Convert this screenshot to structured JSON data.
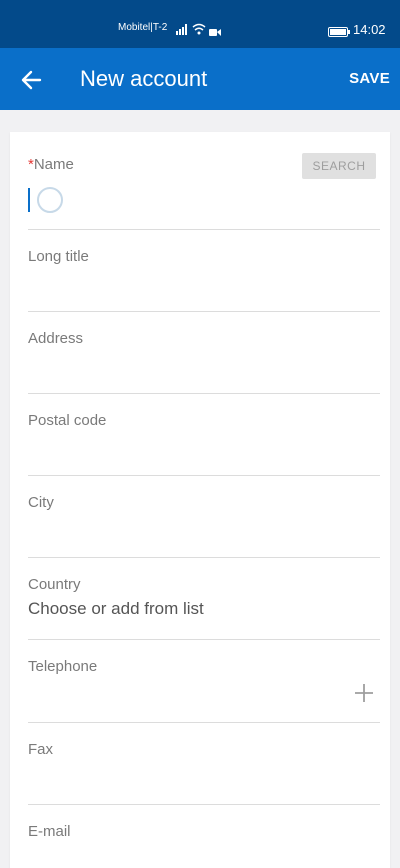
{
  "status_bar": {
    "carrier": "Mobitel|T-2",
    "time": "14:02"
  },
  "app_bar": {
    "title": "New account",
    "save_label": "SAVE"
  },
  "form": {
    "name": {
      "required_mark": "*",
      "label": "Name",
      "search_label": "SEARCH"
    },
    "long_title": {
      "label": "Long title"
    },
    "address": {
      "label": "Address"
    },
    "postal_code": {
      "label": "Postal code"
    },
    "city": {
      "label": "City"
    },
    "country": {
      "label": "Country",
      "value": "Choose or add from list"
    },
    "telephone": {
      "label": "Telephone"
    },
    "fax": {
      "label": "Fax"
    },
    "email": {
      "label": "E-mail"
    }
  },
  "colors": {
    "status_bar": "#034a8a",
    "app_bar": "#0a6fc9",
    "required": "#e53935"
  }
}
